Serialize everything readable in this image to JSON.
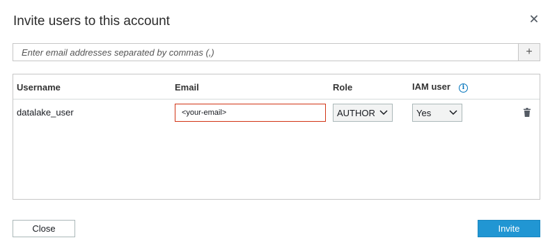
{
  "dialog": {
    "title": "Invite users to this account",
    "close_icon": "close-icon"
  },
  "email_entry": {
    "placeholder": "Enter email addresses separated by commas (,)",
    "value": "",
    "add_label": "+"
  },
  "table": {
    "headers": {
      "username": "Username",
      "email": "Email",
      "role": "Role",
      "iam_user": "IAM user"
    },
    "info_icon": "info-icon",
    "rows": [
      {
        "username": "datalake_user",
        "email_value": "<your-email>",
        "role": "AUTHOR",
        "iam_user": "Yes",
        "delete_icon": "trash-icon"
      }
    ]
  },
  "footer": {
    "close_label": "Close",
    "invite_label": "Invite"
  },
  "colors": {
    "primary_button": "#2196d3",
    "error_border": "#d13212",
    "info_blue": "#0073bb"
  }
}
